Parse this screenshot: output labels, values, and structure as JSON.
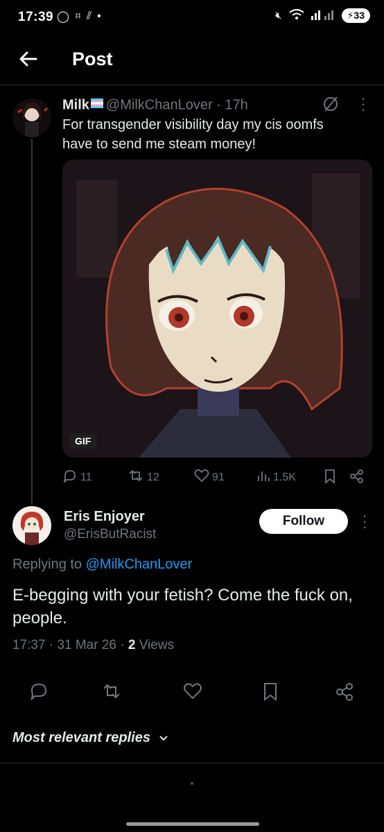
{
  "status_bar": {
    "time": "17:39",
    "battery": "33"
  },
  "header": {
    "title": "Post"
  },
  "tweet": {
    "display_name": "Milk",
    "handle": "@MilkChanLover",
    "age": "17h",
    "text": "For transgender visibility day my cis oomfs have to send me steam money!",
    "media_badge": "GIF",
    "replies": "11",
    "reposts": "12",
    "likes": "91",
    "views": "1.5K"
  },
  "reply": {
    "display_name": "Eris Enjoyer",
    "handle": "@ErisButRacist",
    "follow_label": "Follow",
    "replying_prefix": "Replying to",
    "replying_to": "@MilkChanLover",
    "text": "E-begging with your fetish? Come the fuck on, people.",
    "time": "17:37",
    "date": "31 Mar 26",
    "views_count": "2",
    "views_label": "Views"
  },
  "replies_sort": {
    "label": "Most relevant replies"
  },
  "colors": {
    "background": "#000000",
    "text": "#e7e9ea",
    "muted": "#71767b",
    "link": "#1d9bf0"
  },
  "icons": [
    "back-arrow-icon",
    "grok-icon",
    "more-icon",
    "reply-icon",
    "repost-icon",
    "like-icon",
    "views-icon",
    "bookmark-icon",
    "share-icon",
    "chevron-down-icon"
  ]
}
